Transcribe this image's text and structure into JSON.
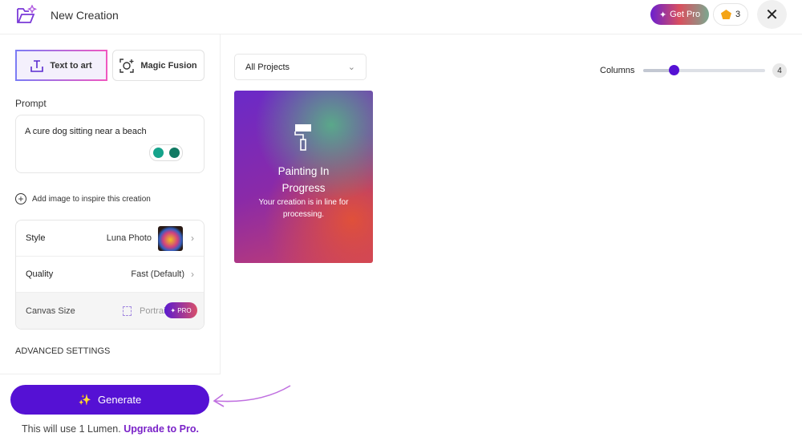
{
  "header": {
    "title": "New Creation",
    "get_pro": "Get Pro",
    "lumens": "3"
  },
  "sidebar": {
    "tabs": [
      {
        "label": "Text to art",
        "active": true
      },
      {
        "label": "Magic Fusion",
        "active": false
      }
    ],
    "prompt_label": "Prompt",
    "prompt_value": "A cure dog sitting near a beach",
    "add_image": "Add image to inspire this creation",
    "settings": [
      {
        "key": "Style",
        "value": "Luna Photo"
      },
      {
        "key": "Quality",
        "value": "Fast (Default)"
      },
      {
        "key": "Canvas Size",
        "value": "Portrait (4:5)",
        "badge": "PRO"
      }
    ],
    "advanced": "ADVANCED SETTINGS",
    "generate": "Generate",
    "uses_text": "This will use 1 Lumen.",
    "upgrade": "Upgrade to Pro."
  },
  "main": {
    "dropdown": "All Projects",
    "columns_label": "Columns",
    "columns_value": 4,
    "columns_display": "4",
    "card": {
      "title": "Painting In Progress",
      "subtitle": "Your creation is in line for processing."
    }
  },
  "colors": {
    "accent": "#5511d4",
    "upgrade": "#7a22c8"
  }
}
